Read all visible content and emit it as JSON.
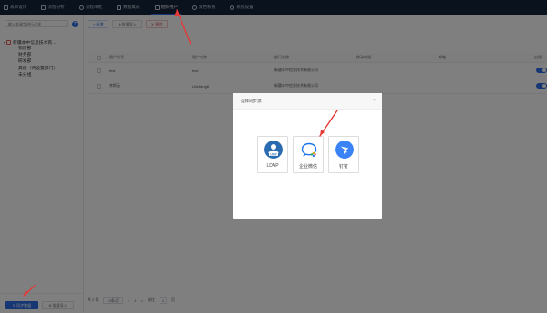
{
  "nav": {
    "items": [
      {
        "label": "表单设计",
        "active": false
      },
      {
        "label": "流程分析",
        "active": false
      },
      {
        "label": "流程审批",
        "active": false
      },
      {
        "label": "数据集成",
        "active": false
      },
      {
        "label": "组织用户",
        "active": true
      },
      {
        "label": "角色权限",
        "active": false
      },
      {
        "label": "系统设置",
        "active": false
      }
    ]
  },
  "left": {
    "search_placeholder": "输入关键字进行过滤",
    "add_icon": "+",
    "tree_root": "新疆本中信息技术有...",
    "tree_children": [
      "销售部",
      "财务部",
      "研发部",
      "其他（待设置部门）",
      "未分组"
    ],
    "sync_button": "⟳ 同步数据",
    "batch_import_button": "⊕ 批量导入"
  },
  "toolbar": {
    "add": "+ 新增",
    "batch_import": "⊕ 批量导入",
    "delete": "✕ 删除"
  },
  "table": {
    "headers": [
      "用户账号",
      "用户名称",
      "部门名称",
      "移动电话",
      "邮箱",
      "启用"
    ],
    "rows": [
      {
        "account": "test",
        "name": "test",
        "dept": "新疆本中信息技术有限公司"
      },
      {
        "account": "李斯云",
        "name": "Lilizhang8",
        "dept": "新疆本中信息技术有限公司"
      }
    ]
  },
  "pager": {
    "total": "共 2 条",
    "page_size": "10条/页",
    "prev": "<",
    "current": "1",
    "next": ">",
    "goto_label": "前往",
    "goto_value": "1",
    "page_suffix": "页"
  },
  "modal": {
    "title": "选择同步源",
    "close": "×",
    "options": [
      {
        "label": "LDAP",
        "icon": "ldap-icon",
        "color": "#2b6cb0"
      },
      {
        "label": "企业微信",
        "icon": "wecom-icon",
        "color": "#1a73e8"
      },
      {
        "label": "钉钉",
        "icon": "dingtalk-icon",
        "color": "#3a83f7"
      }
    ]
  },
  "colors": {
    "nav_bg": "#15243b",
    "primary": "#2f6fe8",
    "annotation": "#e53935"
  }
}
